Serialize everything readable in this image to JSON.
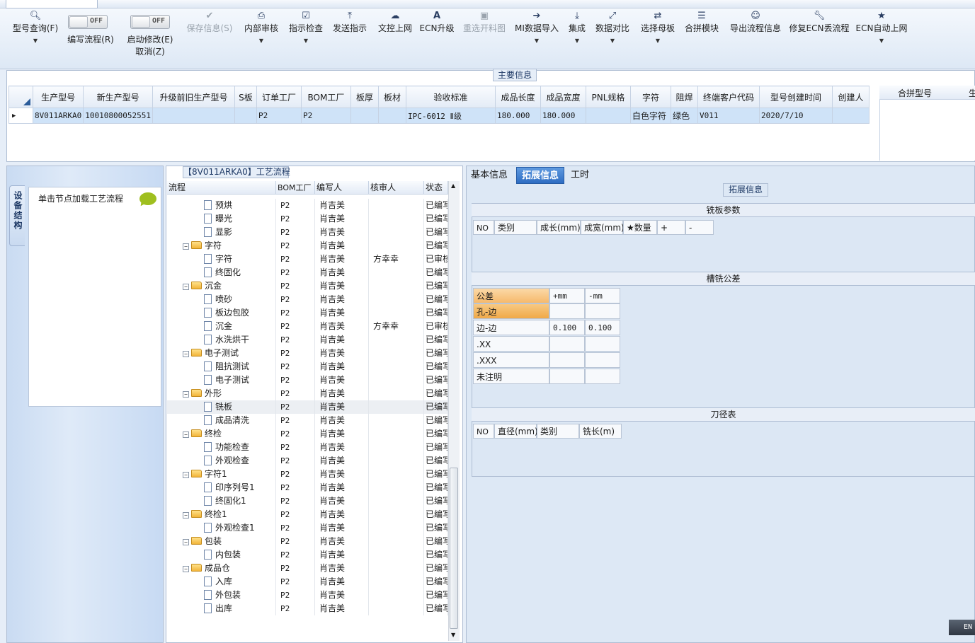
{
  "toolbar": {
    "buttons": [
      {
        "label": "型号查询(F)",
        "icon": "search-icon"
      },
      {
        "label": "保存信息(S)",
        "icon": "check-icon"
      },
      {
        "label": "内部审核",
        "icon": "print-icon"
      },
      {
        "label": "指示检查",
        "icon": "checkbox-icon"
      },
      {
        "label": "发送指示",
        "icon": "upload-icon"
      },
      {
        "label": "文控上网",
        "icon": "cloud-upload-icon"
      },
      {
        "label": "ECN升级",
        "icon": "font-icon"
      },
      {
        "label": "重选开料图",
        "icon": "image-icon"
      },
      {
        "label": "MI数据导入",
        "icon": "import-icon"
      },
      {
        "label": "集成",
        "icon": "download-icon"
      },
      {
        "label": "数据对比",
        "icon": "compress-icon"
      },
      {
        "label": "选择母板",
        "icon": "shuffle-icon"
      },
      {
        "label": "合拼模块",
        "icon": "list-icon"
      },
      {
        "label": "导出流程信息",
        "icon": "smile-icon"
      },
      {
        "label": "修复ECN丢流程",
        "icon": "wrench-icon"
      },
      {
        "label": "ECN自动上网",
        "icon": "star-icon"
      }
    ],
    "toggle_off": "OFF",
    "write_flow_label": "编写流程(R)",
    "start_modify_label": "启动修改(E)",
    "cancel_label": "取消(Z)"
  },
  "main_info": {
    "legend": "主要信息",
    "columns": [
      "生产型号",
      "新生产型号",
      "升级前旧生产型号",
      "S板",
      "订单工厂",
      "BOM工厂",
      "板厚",
      "板材",
      "验收标准",
      "成品长度",
      "成品宽度",
      "PNL规格",
      "字符",
      "阻焊",
      "终端客户代码",
      "型号创建时间",
      "创建人"
    ],
    "row": [
      "8V011ARKA0",
      "10010800052551",
      "",
      "",
      "P2",
      "P2",
      "",
      "",
      "IPC-6012 Ⅱ级",
      "180.000",
      "180.000",
      "",
      "白色字符",
      "绿色",
      "V011",
      "2020/7/10",
      ""
    ],
    "merge_columns": [
      "合拼型号",
      "生"
    ]
  },
  "left_panel": {
    "vertical_tab": "设备结构",
    "node_hint": "单击节点加载工艺流程"
  },
  "tree": {
    "title": "【8V011ARKA0】工艺流程",
    "columns": [
      "流程",
      "BOM工厂",
      "编写人",
      "核审人",
      "状态"
    ],
    "rows": [
      {
        "name": "预烘",
        "type": "doc",
        "bom": "P2",
        "writer": "肖吉美",
        "reviewer": "",
        "status": "已编写"
      },
      {
        "name": "曝光",
        "type": "doc",
        "bom": "P2",
        "writer": "肖吉美",
        "reviewer": "",
        "status": "已编写"
      },
      {
        "name": "显影",
        "type": "doc",
        "bom": "P2",
        "writer": "肖吉美",
        "reviewer": "",
        "status": "已编写"
      },
      {
        "name": "字符",
        "type": "folder",
        "bom": "P2",
        "writer": "肖吉美",
        "reviewer": "",
        "status": "已编写"
      },
      {
        "name": "字符",
        "type": "doc",
        "bom": "P2",
        "writer": "肖吉美",
        "reviewer": "方幸幸",
        "status": "已审核"
      },
      {
        "name": "终固化",
        "type": "doc",
        "bom": "P2",
        "writer": "肖吉美",
        "reviewer": "",
        "status": "已编写"
      },
      {
        "name": "沉金",
        "type": "folder",
        "bom": "P2",
        "writer": "肖吉美",
        "reviewer": "",
        "status": "已编写"
      },
      {
        "name": "喷砂",
        "type": "doc",
        "bom": "P2",
        "writer": "肖吉美",
        "reviewer": "",
        "status": "已编写"
      },
      {
        "name": "板边包胶",
        "type": "doc",
        "bom": "P2",
        "writer": "肖吉美",
        "reviewer": "",
        "status": "已编写"
      },
      {
        "name": "沉金",
        "type": "doc",
        "bom": "P2",
        "writer": "肖吉美",
        "reviewer": "方幸幸",
        "status": "已审核"
      },
      {
        "name": "水洗烘干",
        "type": "doc",
        "bom": "P2",
        "writer": "肖吉美",
        "reviewer": "",
        "status": "已编写"
      },
      {
        "name": "电子测试",
        "type": "folder",
        "bom": "P2",
        "writer": "肖吉美",
        "reviewer": "",
        "status": "已编写"
      },
      {
        "name": "阻抗测试",
        "type": "doc",
        "bom": "P2",
        "writer": "肖吉美",
        "reviewer": "",
        "status": "已编写"
      },
      {
        "name": "电子测试",
        "type": "doc",
        "bom": "P2",
        "writer": "肖吉美",
        "reviewer": "",
        "status": "已编写"
      },
      {
        "name": "外形",
        "type": "folder",
        "bom": "P2",
        "writer": "肖吉美",
        "reviewer": "",
        "status": "已编写"
      },
      {
        "name": "铣板",
        "type": "doc",
        "bom": "P2",
        "writer": "肖吉美",
        "reviewer": "",
        "status": "已编写",
        "selected": true
      },
      {
        "name": "成品清洗",
        "type": "doc",
        "bom": "P2",
        "writer": "肖吉美",
        "reviewer": "",
        "status": "已编写"
      },
      {
        "name": "终检",
        "type": "folder",
        "bom": "P2",
        "writer": "肖吉美",
        "reviewer": "",
        "status": "已编写"
      },
      {
        "name": "功能检查",
        "type": "doc",
        "bom": "P2",
        "writer": "肖吉美",
        "reviewer": "",
        "status": "已编写"
      },
      {
        "name": "外观检查",
        "type": "doc",
        "bom": "P2",
        "writer": "肖吉美",
        "reviewer": "",
        "status": "已编写"
      },
      {
        "name": "字符1",
        "type": "folder",
        "bom": "P2",
        "writer": "肖吉美",
        "reviewer": "",
        "status": "已编写"
      },
      {
        "name": "印序列号1",
        "type": "doc",
        "bom": "P2",
        "writer": "肖吉美",
        "reviewer": "",
        "status": "已编写"
      },
      {
        "name": "终固化1",
        "type": "doc",
        "bom": "P2",
        "writer": "肖吉美",
        "reviewer": "",
        "status": "已编写"
      },
      {
        "name": "终检1",
        "type": "folder",
        "bom": "P2",
        "writer": "肖吉美",
        "reviewer": "",
        "status": "已编写"
      },
      {
        "name": "外观检查1",
        "type": "doc",
        "bom": "P2",
        "writer": "肖吉美",
        "reviewer": "",
        "status": "已编写"
      },
      {
        "name": "包装",
        "type": "folder",
        "bom": "P2",
        "writer": "肖吉美",
        "reviewer": "",
        "status": "已编写"
      },
      {
        "name": "内包装",
        "type": "doc",
        "bom": "P2",
        "writer": "肖吉美",
        "reviewer": "",
        "status": "已编写"
      },
      {
        "name": "成品仓",
        "type": "folder",
        "bom": "P2",
        "writer": "肖吉美",
        "reviewer": "",
        "status": "已编写"
      },
      {
        "name": "入库",
        "type": "doc",
        "bom": "P2",
        "writer": "肖吉美",
        "reviewer": "",
        "status": "已编写"
      },
      {
        "name": "外包装",
        "type": "doc",
        "bom": "P2",
        "writer": "肖吉美",
        "reviewer": "",
        "status": "已编写"
      },
      {
        "name": "出库",
        "type": "doc",
        "bom": "P2",
        "writer": "肖吉美",
        "reviewer": "",
        "status": "已编写"
      }
    ]
  },
  "right_tabs": [
    "基本信息",
    "拓展信息",
    "工时"
  ],
  "extended": {
    "legend": "拓展信息",
    "milling_title": "铣板参数",
    "milling_columns": [
      "NO",
      "类别",
      "成长(mm)",
      "成宽(mm)",
      "★数量",
      "+",
      "-"
    ],
    "tolerance_title": "槽铣公差",
    "tolerance_header": [
      "公差",
      "+mm",
      "-mm"
    ],
    "tolerance_rows": [
      {
        "label": "孔-边",
        "plus": "",
        "minus": ""
      },
      {
        "label": "边-边",
        "plus": "0.100",
        "minus": "0.100"
      },
      {
        "label": ".XX",
        "plus": "",
        "minus": ""
      },
      {
        "label": ".XXX",
        "plus": "",
        "minus": ""
      },
      {
        "label": "未注明",
        "plus": "",
        "minus": ""
      }
    ],
    "tool_title": "刀径表",
    "tool_columns": [
      "NO",
      "直径(mm)",
      "类别",
      "铣长(m)"
    ]
  },
  "status_bar": {
    "ime": "EN"
  }
}
